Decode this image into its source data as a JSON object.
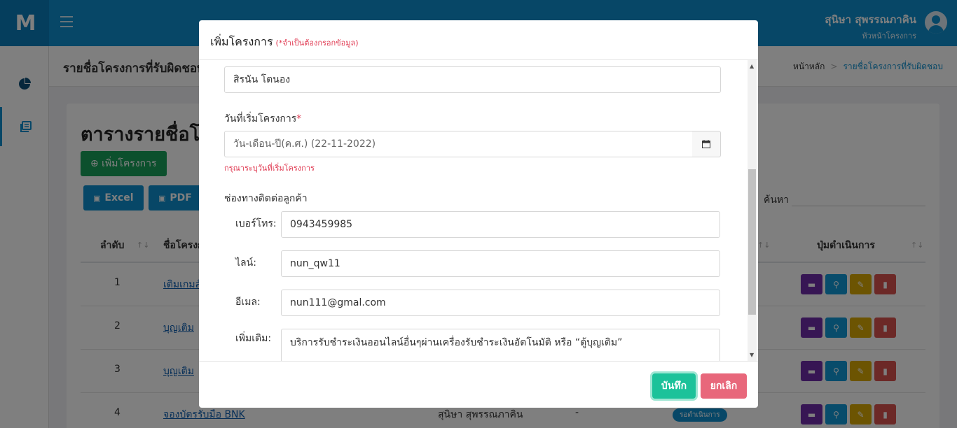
{
  "app": {
    "logo": "M"
  },
  "header": {
    "user_name": "สุนิษา สุพรรณภาคิน",
    "user_role": "หัวหน้าโครงการ"
  },
  "page": {
    "heading": "รายชื่อโครงการที่รับผิดชอบ",
    "crumb_home": "หน้าหลัก",
    "crumb_sep": ">",
    "crumb_current": "รายชื่อโครงการที่รับผิดชอบ"
  },
  "card": {
    "title": "ตารางรายชื่อโครงการ",
    "add_button": "⊕ เพิ่มโครงการ",
    "export_excel": "Excel",
    "export_pdf": "PDF",
    "search_label": "ค้นหา",
    "columns": {
      "no": "ลำดับ",
      "name": "ชื่อโครงการ",
      "actions": "ปุ่มดำเนินการ"
    },
    "rows": [
      {
        "no": "1",
        "name": "เติมเกมส์",
        "owner": "",
        "dash": "",
        "badge": ""
      },
      {
        "no": "2",
        "name": "บุญเติม",
        "owner": "",
        "dash": "",
        "badge": ""
      },
      {
        "no": "3",
        "name": "บุญเติม",
        "owner": "",
        "dash": "",
        "badge": ""
      },
      {
        "no": "4",
        "name": "จองบัตรรับมือ BNK",
        "owner": "สุนิษา สุพรรณภาคิน",
        "dash": "-",
        "badge": "รอดำเนินการ"
      }
    ]
  },
  "modal": {
    "title": "เพิ่มโครงการ",
    "required_note": "(*จำเป็นต้องกรอกข้อมูล)",
    "owner_value": "สิรนัน โตนอง",
    "start_label": "วันที่เริ่มโครงการ",
    "required_star": "*",
    "start_placeholder": "วัน-เดือน-ปี(ค.ศ.) (22-11-2022)",
    "start_error": "กรุณาระบุวันที่เริ่มโครงการ",
    "contact_label": "ช่องทางติดต่อลูกค้า",
    "phone_label": "เบอร์โทร:",
    "phone_value": "0943459985",
    "line_label": "ไลน์:",
    "line_value": "nun_qw11",
    "email_label": "อีเมล:",
    "email_value": "nun111@gmal.com",
    "more_label": "เพิ่มเติม:",
    "more_value": "บริการรับชำระเงินออนไลน์อื่นๆผ่านเครื่องรับชำระเงินอัตโนมัติ หรือ “ตู้บุญเติม”",
    "save_button": "บันทึก",
    "cancel_button": "ยกเลิก"
  },
  "icons": {
    "calendar": "calendar-icon",
    "chart": "pie-chart-icon",
    "list": "list-icon"
  },
  "colors": {
    "primary": "#0e8fce",
    "success": "#1cc29a",
    "danger": "#e8677b",
    "required": "#e03a52"
  }
}
